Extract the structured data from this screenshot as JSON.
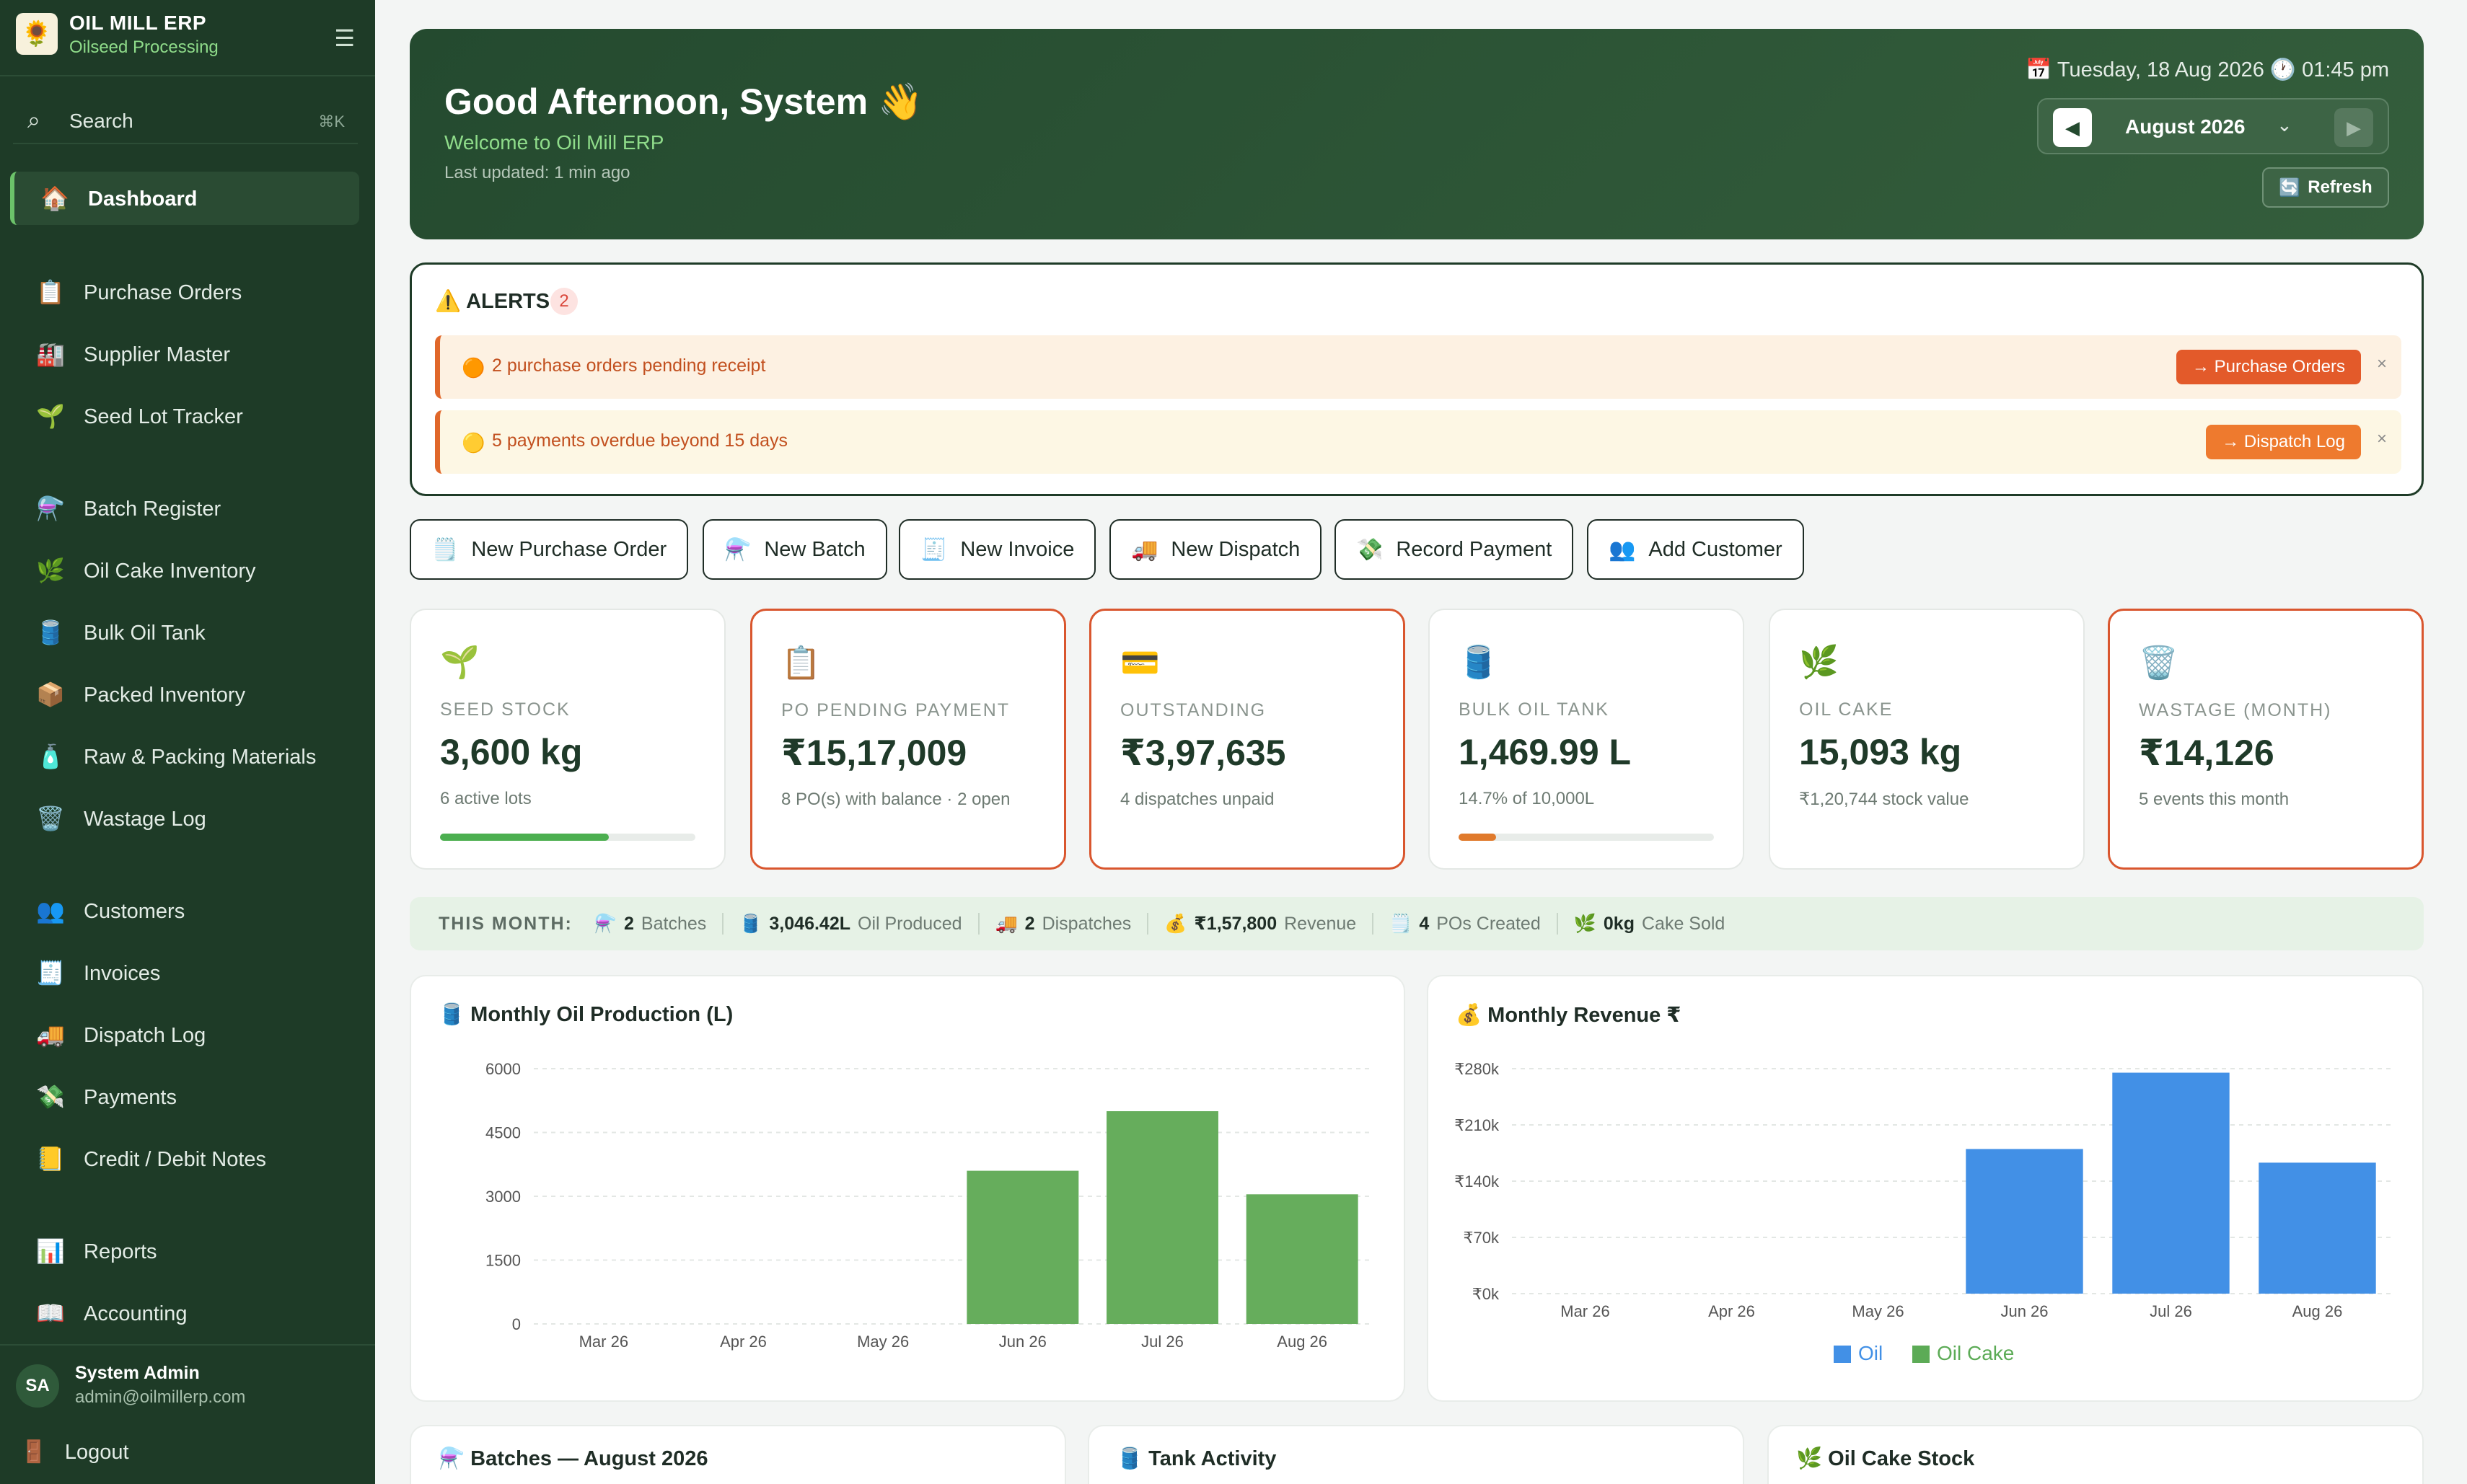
{
  "sidebar": {
    "brand_title": "OIL MILL ERP",
    "brand_sub": "Oilseed Processing",
    "search_label": "Search",
    "search_kbd": "⌘K",
    "items": [
      {
        "label": "Dashboard",
        "icon": "🏠"
      },
      {
        "label": "Purchase Orders",
        "icon": "📋"
      },
      {
        "label": "Supplier Master",
        "icon": "🏭"
      },
      {
        "label": "Seed Lot Tracker",
        "icon": "🌱"
      },
      {
        "label": "Batch Register",
        "icon": "⚗️"
      },
      {
        "label": "Oil Cake Inventory",
        "icon": "🌿"
      },
      {
        "label": "Bulk Oil Tank",
        "icon": "🛢️"
      },
      {
        "label": "Packed Inventory",
        "icon": "📦"
      },
      {
        "label": "Raw & Packing Materials",
        "icon": "🧴"
      },
      {
        "label": "Wastage Log",
        "icon": "🗑️"
      },
      {
        "label": "Customers",
        "icon": "👥"
      },
      {
        "label": "Invoices",
        "icon": "🧾"
      },
      {
        "label": "Dispatch Log",
        "icon": "🚚"
      },
      {
        "label": "Payments",
        "icon": "💸"
      },
      {
        "label": "Credit / Debit Notes",
        "icon": "📒"
      },
      {
        "label": "Reports",
        "icon": "📊"
      },
      {
        "label": "Accounting",
        "icon": "📖"
      }
    ],
    "user_initials": "SA",
    "user_name": "System Admin",
    "user_email": "admin@oilmillerp.com",
    "logout": "Logout"
  },
  "hero": {
    "greeting": "Good Afternoon, System 👋",
    "welcome": "Welcome to Oil Mill ERP",
    "updated": "Last updated: 1 min ago",
    "datetime": "📅 Tuesday, 18 Aug 2026   🕐 01:45 pm",
    "month": "August 2026",
    "refresh": "Refresh"
  },
  "alerts": {
    "title": "⚠️ ALERTS",
    "count": "2",
    "items": [
      {
        "message": "2 purchase orders pending receipt",
        "action": "→ Purchase Orders",
        "bg": "#fdf1e2",
        "text": "#c2501f"
      },
      {
        "message": "5 payments overdue beyond 15 days",
        "action": "→ Dispatch Log",
        "bg": "#fdf7e4",
        "text": "#c2501f"
      }
    ]
  },
  "quick_actions": [
    {
      "label": "New Purchase Order",
      "icon": "🗒️"
    },
    {
      "label": "New Batch",
      "icon": "⚗️"
    },
    {
      "label": "New Invoice",
      "icon": "🧾"
    },
    {
      "label": "New Dispatch",
      "icon": "🚚"
    },
    {
      "label": "Record Payment",
      "icon": "💸"
    },
    {
      "label": "Add Customer",
      "icon": "👥"
    }
  ],
  "kpis": [
    {
      "icon": "🌱",
      "label": "SEED STOCK",
      "value": "3,600 kg",
      "sub": "6 active lots",
      "progress": 0.66,
      "bar_color": "#4caf50",
      "warn": false
    },
    {
      "icon": "📋",
      "label": "PO PENDING PAYMENT",
      "value": "₹15,17,009",
      "sub": "8 PO(s) with balance · 2 open",
      "warn": true
    },
    {
      "icon": "💳",
      "label": "OUTSTANDING",
      "value": "₹3,97,635",
      "sub": "4 dispatches unpaid",
      "warn": true
    },
    {
      "icon": "🛢️",
      "label": "BULK OIL TANK",
      "value": "1,469.99 L",
      "sub": "14.7% of 10,000L",
      "progress": 0.147,
      "bar_color": "#e07a2c",
      "warn": false
    },
    {
      "icon": "🌿",
      "label": "OIL CAKE",
      "value": "15,093 kg",
      "sub": "₹1,20,744 stock value",
      "warn": false
    },
    {
      "icon": "🗑️",
      "label": "WASTAGE (MONTH)",
      "value": "₹14,126",
      "sub": "5 events this month",
      "warn": true
    }
  ],
  "this_month": {
    "title": "THIS MONTH:",
    "items": [
      {
        "icon": "⚗️",
        "value": "2",
        "label": "Batches"
      },
      {
        "icon": "🛢️",
        "value": "3,046.42L",
        "label": "Oil Produced"
      },
      {
        "icon": "🚚",
        "value": "2",
        "label": "Dispatches"
      },
      {
        "icon": "💰",
        "value": "₹1,57,800",
        "label": "Revenue"
      },
      {
        "icon": "🗒️",
        "value": "4",
        "label": "POs Created"
      },
      {
        "icon": "🌿",
        "value": "0kg",
        "label": "Cake Sold"
      }
    ]
  },
  "chart_data": [
    {
      "type": "bar",
      "title": "🛢️ Monthly Oil Production (L)",
      "categories": [
        "Mar 26",
        "Apr 26",
        "May 26",
        "Jun 26",
        "Jul 26",
        "Aug 26"
      ],
      "series": [
        {
          "values": [
            0,
            0,
            0,
            3600,
            5000,
            3046
          ],
          "color": "#66ad5c"
        }
      ],
      "yticks": [
        "0",
        "1500",
        "3000",
        "4500",
        "6000"
      ],
      "ylim": [
        0,
        6000
      ]
    },
    {
      "type": "bar",
      "title": "💰 Monthly Revenue ₹",
      "categories": [
        "Mar 26",
        "Apr 26",
        "May 26",
        "Jun 26",
        "Jul 26",
        "Aug 26"
      ],
      "series": [
        {
          "name": "Oil",
          "values": [
            0,
            0,
            0,
            180000,
            275000,
            163000
          ],
          "color": "#4290e6"
        },
        {
          "name": "Oil Cake",
          "values": [
            0,
            0,
            0,
            0,
            0,
            0
          ],
          "color": "#5cab56"
        }
      ],
      "yticks": [
        "₹0k",
        "₹70k",
        "₹140k",
        "₹210k",
        "₹280k"
      ],
      "ylim": [
        0,
        280000
      ],
      "legend": "bottom"
    }
  ],
  "bottom_cards": [
    {
      "title": "⚗️ Batches — August 2026"
    },
    {
      "title": "🛢️ Tank Activity"
    },
    {
      "title": "🌿 Oil Cake Stock"
    }
  ]
}
